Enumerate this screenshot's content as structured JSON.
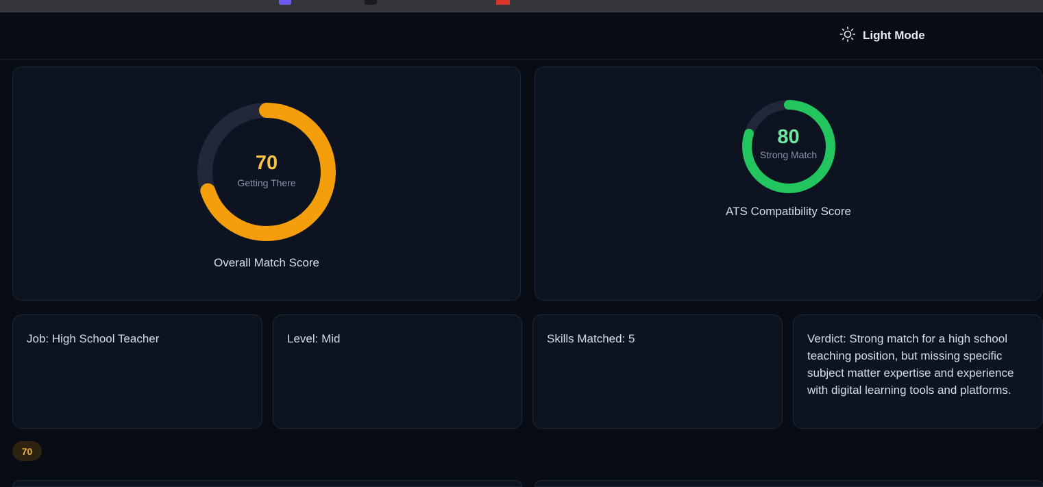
{
  "header": {
    "theme_toggle_label": "Light Mode",
    "theme_icon": "sun-icon"
  },
  "scores": {
    "overall": {
      "value": "70",
      "status": "Getting There",
      "caption": "Overall Match Score",
      "percent": 70,
      "color": "#f59e0b",
      "value_color": "#f6c445"
    },
    "ats": {
      "value": "80",
      "status": "Strong Match",
      "caption": "ATS Compatibility Score",
      "percent": 80,
      "color": "#22c55e",
      "value_color": "#6ee7a0"
    }
  },
  "details": {
    "job": "Job: High School Teacher",
    "level": "Level: Mid",
    "skills": "Skills Matched: 5",
    "verdict": "Verdict: Strong match for a high school teaching position, but missing specific subject matter expertise and experience with digital learning tools and platforms."
  },
  "badge": {
    "value": "70"
  },
  "colors": {
    "background": "#080c15",
    "card": "#0e1321",
    "track": "#22283a"
  }
}
